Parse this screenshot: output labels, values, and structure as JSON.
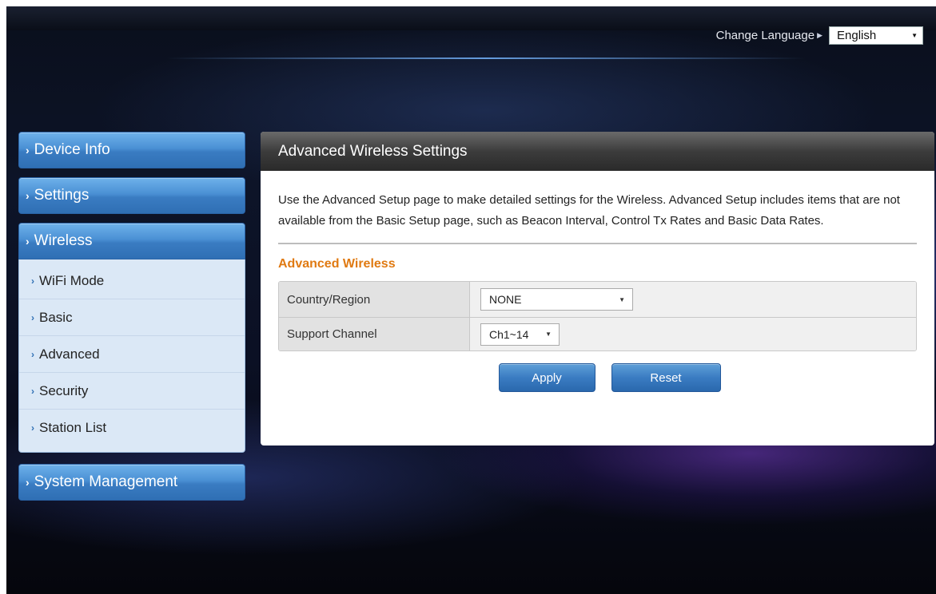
{
  "header": {
    "change_language_label": "Change Language",
    "language_selected": "English"
  },
  "sidebar": {
    "items": [
      {
        "label": "Device Info"
      },
      {
        "label": "Settings"
      },
      {
        "label": "Wireless"
      },
      {
        "label": "System Management"
      }
    ],
    "wireless_submenu": [
      {
        "label": "WiFi Mode"
      },
      {
        "label": "Basic"
      },
      {
        "label": "Advanced"
      },
      {
        "label": "Security"
      },
      {
        "label": "Station List"
      }
    ]
  },
  "main": {
    "title": "Advanced Wireless Settings",
    "description": "Use the Advanced Setup page to make detailed settings for the Wireless. Advanced Setup includes items that are not available from the Basic Setup page, such as Beacon Interval, Control Tx Rates and Basic Data Rates.",
    "section_title": "Advanced Wireless",
    "fields": {
      "country_label": "Country/Region",
      "country_value": "NONE",
      "channel_label": "Support Channel",
      "channel_value": "Ch1~14"
    },
    "apply_label": "Apply",
    "reset_label": "Reset"
  },
  "colors": {
    "accent_blue": "#3a7cc2",
    "section_orange": "#e07a12",
    "header_dark": "#3c3c3c"
  }
}
